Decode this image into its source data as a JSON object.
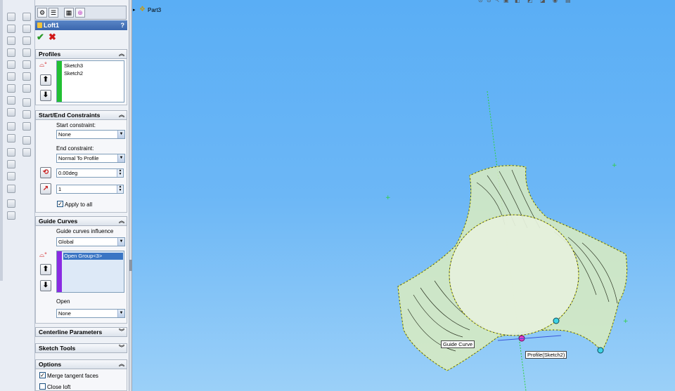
{
  "feature_manager": {
    "title": "Loft1",
    "help": "?"
  },
  "tree": {
    "part_name": "Part3"
  },
  "profiles": {
    "header": "Profiles",
    "items": [
      "Sketch3",
      "Sketch2"
    ]
  },
  "constraints": {
    "header": "Start/End Constraints",
    "start_label": "Start constraint:",
    "start_value": "None",
    "end_label": "End constraint:",
    "end_value": "Normal To Profile",
    "angle_value": "0.00deg",
    "tangent_length_value": "1",
    "apply_all_label": "Apply to all",
    "apply_all_checked": true
  },
  "guide_curves": {
    "header": "Guide Curves",
    "influence_label": "Guide curves influence",
    "influence_value": "Global",
    "items": [
      "Open Group<3>"
    ],
    "open_label": "Open",
    "open_value": "None"
  },
  "centerline": {
    "header": "Centerline Parameters"
  },
  "sketch_tools": {
    "header": "Sketch Tools"
  },
  "options": {
    "header": "Options",
    "merge_label": "Merge tangent faces",
    "merge_checked": true,
    "close_label": "Close loft",
    "close_checked": false
  },
  "viewport": {
    "guide_curve_tag": "Guide Curve",
    "profile_tag": "Profile(Sketch2)"
  },
  "colors": {
    "viewport_top": "#5aaef5",
    "viewport_bottom": "#9bd0f8",
    "profile_bar": "#22c033",
    "guide_bar": "#8a2be2",
    "selection": "#3a75c4"
  }
}
